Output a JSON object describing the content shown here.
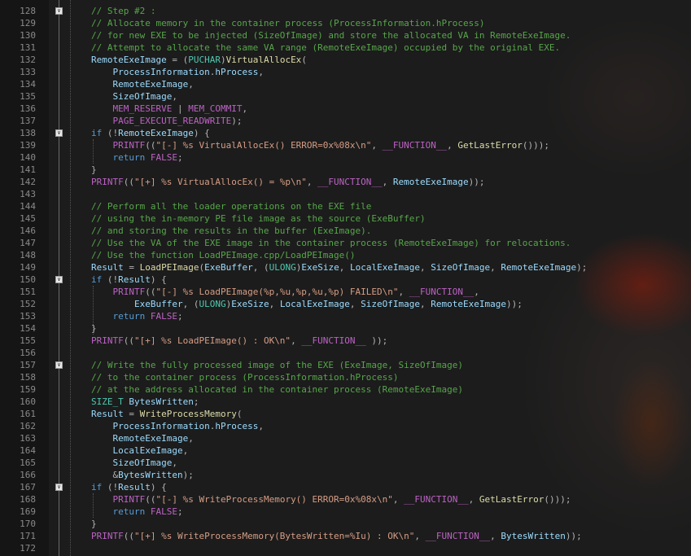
{
  "editor": {
    "first_line": 128,
    "fold_lines": [
      128,
      138,
      150,
      157,
      167
    ],
    "lines": [
      [
        [
          "cm",
          "// Step #2 :"
        ]
      ],
      [
        [
          "cm",
          "// Allocate memory in the container process (ProcessInformation.hProcess)"
        ]
      ],
      [
        [
          "cm",
          "// for new EXE to be injected (SizeOfImage) and store the allocated VA in RemoteExeImage."
        ]
      ],
      [
        [
          "cm",
          "// Attempt to allocate the same VA range (RemoteExeImage) occupied by the original EXE."
        ]
      ],
      [
        [
          "va",
          "RemoteExeImage"
        ],
        [
          "op",
          " = ("
        ],
        [
          "ty",
          "PUCHAR"
        ],
        [
          "op",
          ")"
        ],
        [
          "fn",
          "VirtualAllocEx"
        ],
        [
          "op",
          "("
        ]
      ],
      [
        [
          "op",
          "    "
        ],
        [
          "va",
          "ProcessInformation"
        ],
        [
          "op",
          "."
        ],
        [
          "va",
          "hProcess"
        ],
        [
          "op",
          ","
        ]
      ],
      [
        [
          "op",
          "    "
        ],
        [
          "va",
          "RemoteExeImage"
        ],
        [
          "op",
          ","
        ]
      ],
      [
        [
          "op",
          "    "
        ],
        [
          "va",
          "SizeOfImage"
        ],
        [
          "op",
          ","
        ]
      ],
      [
        [
          "op",
          "    "
        ],
        [
          "mc",
          "MEM_RESERVE"
        ],
        [
          "op",
          " | "
        ],
        [
          "mc",
          "MEM_COMMIT"
        ],
        [
          "op",
          ","
        ]
      ],
      [
        [
          "op",
          "    "
        ],
        [
          "mc",
          "PAGE_EXECUTE_READWRITE"
        ],
        [
          "op",
          ");"
        ]
      ],
      [
        [
          "kw",
          "if"
        ],
        [
          "op",
          " (!"
        ],
        [
          "va",
          "RemoteExeImage"
        ],
        [
          "op",
          ") {"
        ]
      ],
      [
        [
          "op",
          "    "
        ],
        [
          "mc",
          "PRINTF"
        ],
        [
          "op",
          "(("
        ],
        [
          "st",
          "\"[-] %s VirtualAllocEx() ERROR=0x%08x\\n\""
        ],
        [
          "op",
          ", "
        ],
        [
          "mc",
          "__FUNCTION__"
        ],
        [
          "op",
          ", "
        ],
        [
          "fn",
          "GetLastError"
        ],
        [
          "op",
          "()));"
        ]
      ],
      [
        [
          "op",
          "    "
        ],
        [
          "kw",
          "return"
        ],
        [
          "op",
          " "
        ],
        [
          "mc",
          "FALSE"
        ],
        [
          "op",
          ";"
        ]
      ],
      [
        [
          "op",
          "}"
        ]
      ],
      [
        [
          "mc",
          "PRINTF"
        ],
        [
          "op",
          "(("
        ],
        [
          "st",
          "\"[+] %s VirtualAllocEx() = %p\\n\""
        ],
        [
          "op",
          ", "
        ],
        [
          "mc",
          "__FUNCTION__"
        ],
        [
          "op",
          ", "
        ],
        [
          "va",
          "RemoteExeImage"
        ],
        [
          "op",
          "));"
        ]
      ],
      [],
      [
        [
          "cm",
          "// Perform all the loader operations on the EXE file"
        ]
      ],
      [
        [
          "cm",
          "// using the in-memory PE file image as the source (ExeBuffer)"
        ]
      ],
      [
        [
          "cm",
          "// and storing the results in the buffer (ExeImage)."
        ]
      ],
      [
        [
          "cm",
          "// Use the VA of the EXE image in the container process (RemoteExeImage) for relocations."
        ]
      ],
      [
        [
          "cm",
          "// Use the function LoadPEImage.cpp/LoadPEImage()"
        ]
      ],
      [
        [
          "va",
          "Result"
        ],
        [
          "op",
          " = "
        ],
        [
          "fn",
          "LoadPEImage"
        ],
        [
          "op",
          "("
        ],
        [
          "va",
          "ExeBuffer"
        ],
        [
          "op",
          ", ("
        ],
        [
          "ty",
          "ULONG"
        ],
        [
          "op",
          ")"
        ],
        [
          "va",
          "ExeSize"
        ],
        [
          "op",
          ", "
        ],
        [
          "va",
          "LocalExeImage"
        ],
        [
          "op",
          ", "
        ],
        [
          "va",
          "SizeOfImage"
        ],
        [
          "op",
          ", "
        ],
        [
          "va",
          "RemoteExeImage"
        ],
        [
          "op",
          ");"
        ]
      ],
      [
        [
          "kw",
          "if"
        ],
        [
          "op",
          " (!"
        ],
        [
          "va",
          "Result"
        ],
        [
          "op",
          ") {"
        ]
      ],
      [
        [
          "op",
          "    "
        ],
        [
          "mc",
          "PRINTF"
        ],
        [
          "op",
          "(("
        ],
        [
          "st",
          "\"[-] %s LoadPEImage(%p,%u,%p,%u,%p) FAILED\\n\""
        ],
        [
          "op",
          ", "
        ],
        [
          "mc",
          "__FUNCTION__"
        ],
        [
          "op",
          ","
        ]
      ],
      [
        [
          "op",
          "        "
        ],
        [
          "va",
          "ExeBuffer"
        ],
        [
          "op",
          ", ("
        ],
        [
          "ty",
          "ULONG"
        ],
        [
          "op",
          ")"
        ],
        [
          "va",
          "ExeSize"
        ],
        [
          "op",
          ", "
        ],
        [
          "va",
          "LocalExeImage"
        ],
        [
          "op",
          ", "
        ],
        [
          "va",
          "SizeOfImage"
        ],
        [
          "op",
          ", "
        ],
        [
          "va",
          "RemoteExeImage"
        ],
        [
          "op",
          "));"
        ]
      ],
      [
        [
          "op",
          "    "
        ],
        [
          "kw",
          "return"
        ],
        [
          "op",
          " "
        ],
        [
          "mc",
          "FALSE"
        ],
        [
          "op",
          ";"
        ]
      ],
      [
        [
          "op",
          "}"
        ]
      ],
      [
        [
          "mc",
          "PRINTF"
        ],
        [
          "op",
          "(("
        ],
        [
          "st",
          "\"[+] %s LoadPEImage() : OK\\n\""
        ],
        [
          "op",
          ", "
        ],
        [
          "mc",
          "__FUNCTION__"
        ],
        [
          "op",
          " ));"
        ]
      ],
      [],
      [
        [
          "cm",
          "// Write the fully processed image of the EXE (ExeImage, SizeOfImage)"
        ]
      ],
      [
        [
          "cm",
          "// to the container process (ProcessInformation.hProcess)"
        ]
      ],
      [
        [
          "cm",
          "// at the address allocated in the container process (RemoteExeImage)"
        ]
      ],
      [
        [
          "ty",
          "SIZE_T"
        ],
        [
          "op",
          " "
        ],
        [
          "va",
          "BytesWritten"
        ],
        [
          "op",
          ";"
        ]
      ],
      [
        [
          "va",
          "Result"
        ],
        [
          "op",
          " = "
        ],
        [
          "fn",
          "WriteProcessMemory"
        ],
        [
          "op",
          "("
        ]
      ],
      [
        [
          "op",
          "    "
        ],
        [
          "va",
          "ProcessInformation"
        ],
        [
          "op",
          "."
        ],
        [
          "va",
          "hProcess"
        ],
        [
          "op",
          ","
        ]
      ],
      [
        [
          "op",
          "    "
        ],
        [
          "va",
          "RemoteExeImage"
        ],
        [
          "op",
          ","
        ]
      ],
      [
        [
          "op",
          "    "
        ],
        [
          "va",
          "LocalExeImage"
        ],
        [
          "op",
          ","
        ]
      ],
      [
        [
          "op",
          "    "
        ],
        [
          "va",
          "SizeOfImage"
        ],
        [
          "op",
          ","
        ]
      ],
      [
        [
          "op",
          "    &"
        ],
        [
          "va",
          "BytesWritten"
        ],
        [
          "op",
          ");"
        ]
      ],
      [
        [
          "kw",
          "if"
        ],
        [
          "op",
          " (!"
        ],
        [
          "va",
          "Result"
        ],
        [
          "op",
          ") {"
        ]
      ],
      [
        [
          "op",
          "    "
        ],
        [
          "mc",
          "PRINTF"
        ],
        [
          "op",
          "(("
        ],
        [
          "st",
          "\"[-] %s WriteProcessMemory() ERROR=0x%08x\\n\""
        ],
        [
          "op",
          ", "
        ],
        [
          "mc",
          "__FUNCTION__"
        ],
        [
          "op",
          ", "
        ],
        [
          "fn",
          "GetLastError"
        ],
        [
          "op",
          "()));"
        ]
      ],
      [
        [
          "op",
          "    "
        ],
        [
          "kw",
          "return"
        ],
        [
          "op",
          " "
        ],
        [
          "mc",
          "FALSE"
        ],
        [
          "op",
          ";"
        ]
      ],
      [
        [
          "op",
          "}"
        ]
      ],
      [
        [
          "mc",
          "PRINTF"
        ],
        [
          "op",
          "(("
        ],
        [
          "st",
          "\"[+] %s WriteProcessMemory(BytesWritten=%Iu) : OK\\n\""
        ],
        [
          "op",
          ", "
        ],
        [
          "mc",
          "__FUNCTION__"
        ],
        [
          "op",
          ", "
        ],
        [
          "va",
          "BytesWritten"
        ],
        [
          "op",
          "));"
        ]
      ],
      []
    ]
  }
}
